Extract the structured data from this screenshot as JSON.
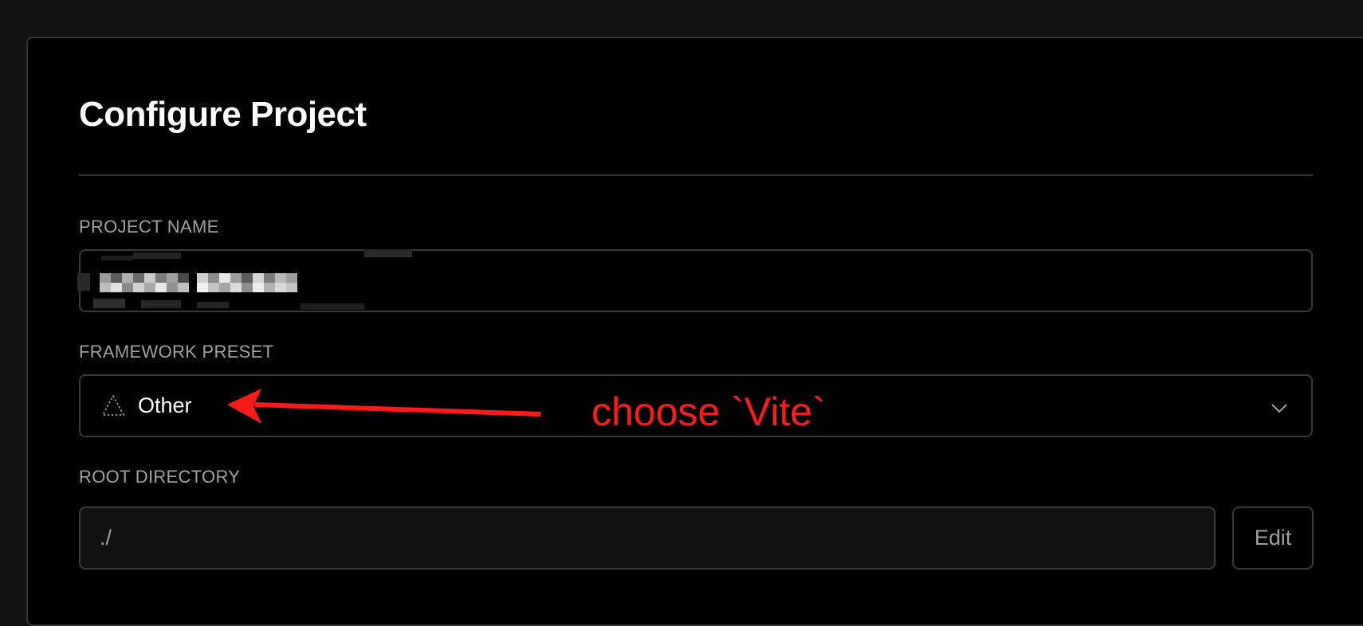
{
  "page": {
    "title": "Configure Project"
  },
  "project_name": {
    "label": "PROJECT NAME",
    "value_redacted": true
  },
  "framework_preset": {
    "label": "FRAMEWORK PRESET",
    "value": "Other",
    "icon": "triangle-dotted-icon"
  },
  "root_directory": {
    "label": "ROOT DIRECTORY",
    "value": "./",
    "edit_label": "Edit"
  },
  "annotation": {
    "text": "choose `Vite`",
    "color": "#ff1a1a"
  },
  "colors": {
    "page_bg": "#111111",
    "card_bg": "#000000",
    "border": "#333333",
    "label": "#a1a1a1",
    "text": "#ffffff"
  }
}
